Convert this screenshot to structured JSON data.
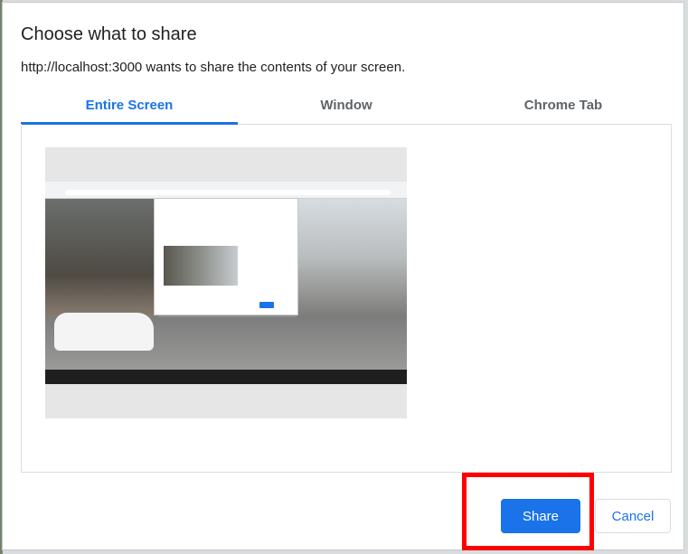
{
  "dialog": {
    "title": "Choose what to share",
    "subtitle": "http://localhost:3000 wants to share the contents of your screen."
  },
  "tabs": [
    {
      "label": "Entire Screen",
      "active": true
    },
    {
      "label": "Window",
      "active": false
    },
    {
      "label": "Chrome Tab",
      "active": false
    }
  ],
  "actions": {
    "share_label": "Share",
    "cancel_label": "Cancel"
  },
  "colors": {
    "accent": "#1a73e8",
    "highlight": "#ff0000"
  }
}
